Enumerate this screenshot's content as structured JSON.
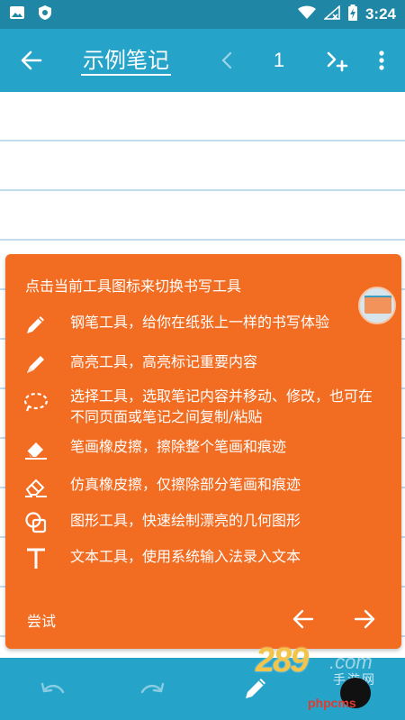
{
  "status_bar": {
    "time": "3:24",
    "icons": [
      "image-icon",
      "shield-icon",
      "wifi-icon",
      "signal-icon",
      "battery-charging-icon"
    ]
  },
  "toolbar": {
    "title": "示例笔记",
    "page_number": "1",
    "icons": [
      "back-arrow-icon",
      "chevron-left-icon",
      "add-page-icon",
      "more-vert-icon"
    ]
  },
  "tooltip": {
    "header": "点击当前工具图标来切换书写工具",
    "items": [
      {
        "icon": "pen-icon",
        "text": "钢笔工具，给你在纸张上一样的书写体验"
      },
      {
        "icon": "highlighter-icon",
        "text": "高亮工具，高亮标记重要内容"
      },
      {
        "icon": "lasso-select-icon",
        "text": "选择工具，选取笔记内容并移动、修改，也可在不同页面或笔记之间复制/粘贴"
      },
      {
        "icon": "stroke-eraser-icon",
        "text": "笔画橡皮擦，擦除整个笔画和痕迹"
      },
      {
        "icon": "pixel-eraser-icon",
        "text": "仿真橡皮擦，仅擦除部分笔画和痕迹"
      },
      {
        "icon": "shape-tool-icon",
        "text": "图形工具，快速绘制漂亮的几何图形"
      },
      {
        "icon": "text-tool-icon",
        "text": "文本工具，使用系统输入法录入文本"
      }
    ],
    "try_label": "尝试"
  },
  "bottom_bar": {
    "icons": [
      "undo-icon",
      "redo-icon",
      "pen-icon"
    ]
  },
  "watermark": {
    "brand": "289",
    "suffix": ".com",
    "subtitle": "手游网",
    "php": "phpcms"
  },
  "colors": {
    "status_bar": "#1f86a6",
    "toolbar": "#26a3c9",
    "tooltip": "#f26c22",
    "paper_line": "#c2dcee"
  }
}
